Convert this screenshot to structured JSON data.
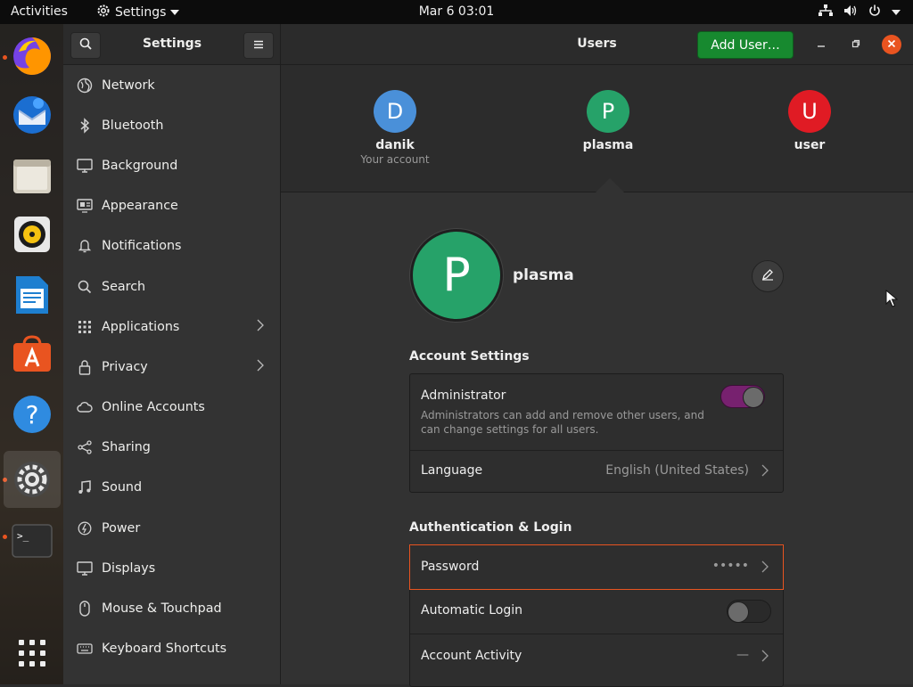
{
  "topbar": {
    "activities": "Activities",
    "app_name": "Settings",
    "clock": "Mar 6  03:01"
  },
  "dock": {
    "items": [
      "firefox-icon",
      "thunderbird-icon",
      "files-icon",
      "rhythmbox-icon",
      "writer-icon",
      "software-icon",
      "help-icon",
      "settings-icon",
      "terminal-icon",
      "show-apps-icon"
    ]
  },
  "sidebar": {
    "title": "Settings",
    "items": [
      {
        "label": "Network",
        "icon": "network-icon"
      },
      {
        "label": "Bluetooth",
        "icon": "bluetooth-icon"
      },
      {
        "label": "Background",
        "icon": "background-icon"
      },
      {
        "label": "Appearance",
        "icon": "appearance-icon"
      },
      {
        "label": "Notifications",
        "icon": "bell-icon"
      },
      {
        "label": "Search",
        "icon": "search-icon"
      },
      {
        "label": "Applications",
        "icon": "grid-icon"
      },
      {
        "label": "Privacy",
        "icon": "lock-icon"
      },
      {
        "label": "Online Accounts",
        "icon": "cloud-icon"
      },
      {
        "label": "Sharing",
        "icon": "share-icon"
      },
      {
        "label": "Sound",
        "icon": "music-note-icon"
      },
      {
        "label": "Power",
        "icon": "power-icon"
      },
      {
        "label": "Displays",
        "icon": "display-icon"
      },
      {
        "label": "Mouse & Touchpad",
        "icon": "mouse-icon"
      },
      {
        "label": "Keyboard Shortcuts",
        "icon": "keyboard-icon"
      }
    ]
  },
  "main": {
    "title": "Users",
    "add_user_label": "Add User…",
    "users": [
      {
        "initial": "D",
        "name": "danik",
        "sub": "Your account",
        "color": "#4a90d9"
      },
      {
        "initial": "P",
        "name": "plasma",
        "sub": "",
        "color": "#26a269"
      },
      {
        "initial": "U",
        "name": "user",
        "sub": "",
        "color": "#e01b24"
      }
    ],
    "profile": {
      "initial": "P",
      "name": "plasma"
    },
    "account_settings": {
      "title": "Account Settings",
      "administrator_label": "Administrator",
      "administrator_desc": "Administrators can add and remove other users, and can change settings for all users.",
      "language_label": "Language",
      "language_value": "English (United States)"
    },
    "auth": {
      "title": "Authentication & Login",
      "password_label": "Password",
      "password_value": "•••••",
      "autologin_label": "Automatic Login",
      "activity_label": "Account Activity",
      "activity_value": "—"
    }
  },
  "colors": {
    "accent": "#e95420",
    "add_user_bg": "#17892f",
    "toggle_on": "#77216f"
  }
}
